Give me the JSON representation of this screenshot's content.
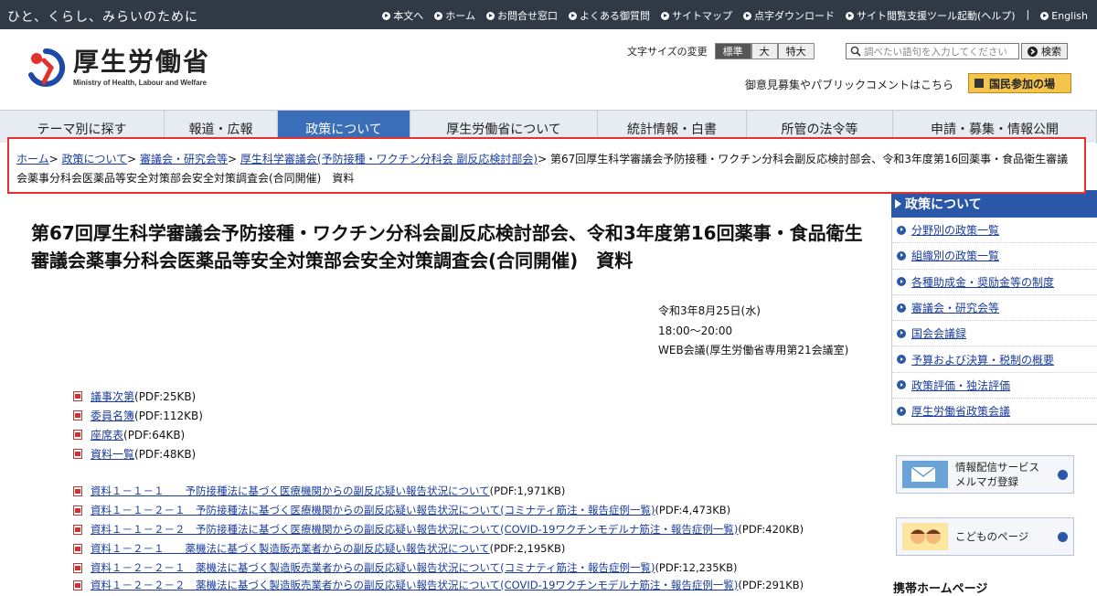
{
  "topbar": {
    "tagline": "ひと、くらし、みらいのために",
    "links": [
      "本文へ",
      "ホーム",
      "お問合せ窓口",
      "よくある御質問",
      "サイトマップ",
      "点字ダウンロード",
      "サイト閲覧支援ツール起動(ヘルプ)"
    ],
    "english": "English"
  },
  "header": {
    "logo_name": "厚生労働省",
    "logo_en": "Ministry of Health, Labour and Welfare",
    "fontsize_label": "文字サイズの変更",
    "fontsize_options": [
      "標準",
      "大",
      "特大"
    ],
    "search_placeholder": "調べたい語句を入力してください",
    "search_button": "検索",
    "public_comment": "御意見募集やパブリックコメントはこちら",
    "kokumin_button": "国民参加の場"
  },
  "nav": [
    "テーマ別に探す",
    "報道・広報",
    "政策について",
    "厚生労働省について",
    "統計情報・白書",
    "所管の法令等",
    "申請・募集・情報公開"
  ],
  "breadcrumb": {
    "links": [
      "ホーム",
      "政策について",
      "審議会・研究会等",
      "厚生科学審議会(予防接種・ワクチン分科会 副反応検討部会)"
    ],
    "current": "第67回厚生科学審議会予防接種・ワクチン分科会副反応検討部会、令和3年度第16回薬事・食品衛生審議会薬事分科会医薬品等安全対策部会安全対策調査会(合同開催)　資料"
  },
  "main": {
    "title": "第67回厚生科学審議会予防接種・ワクチン分科会副反応検討部会、令和3年度第16回薬事・食品衛生審議会薬事分科会医薬品等安全対策部会安全対策調査会(合同開催)　資料",
    "date": "令和3年8月25日(水)",
    "time": "18:00～20:00",
    "venue": "WEB会議(厚生労働省専用第21会議室)",
    "docs1": [
      {
        "label": "議事次第",
        "size": "(PDF:25KB)"
      },
      {
        "label": "委員名簿",
        "size": "(PDF:112KB)"
      },
      {
        "label": "座席表",
        "size": "(PDF:64KB)"
      },
      {
        "label": "資料一覧",
        "size": "(PDF:48KB)"
      }
    ],
    "docs2": [
      {
        "label": "資料１－１－１　　予防接種法に基づく医療機関からの副反応疑い報告状況について",
        "size": "(PDF:1,971KB)"
      },
      {
        "label": "資料１－１－２－１　予防接種法に基づく医療機関からの副反応疑い報告状況について(コミナティ筋注・報告症例一覧)",
        "size": "(PDF:4,473KB)"
      },
      {
        "label": "資料１－１－２－２　予防接種法に基づく医療機関からの副反応疑い報告状況について(COVID-19ワクチンモデルナ筋注・報告症例一覧)",
        "size": "(PDF:420KB)"
      },
      {
        "label": "資料１－２－１　　薬機法に基づく製造販売業者からの副反応疑い報告状況について",
        "size": "(PDF:2,195KB)"
      },
      {
        "label": "資料１－２－２－１　薬機法に基づく製造販売業者からの副反応疑い報告状況について(コミナティ筋注・報告症例一覧)",
        "size": "(PDF:12,235KB)"
      },
      {
        "label": "資料１－２－２－２　薬機法に基づく製造販売業者からの副反応疑い報告状況について(COVID-19ワクチンモデルナ筋注・報告症例一覧)",
        "size": "(PDF:291KB)"
      }
    ]
  },
  "sidebar": {
    "heading": "政策について",
    "items": [
      "分野別の政策一覧",
      "組織別の政策一覧",
      "各種助成金・奨励金等の制度",
      "審議会・研究会等",
      "国会会議録",
      "予算および決算・税制の概要",
      "政策評価・独法評価",
      "厚生労働省政策会議"
    ],
    "banner_mail_1": "情報配信サービス",
    "banner_mail_2": "メルマガ登録",
    "banner_kids": "こどものページ",
    "mobile": "携帯ホームページ"
  },
  "colors": {
    "topbar": "#2f3a46",
    "nav_active": "#3b6eb8",
    "highlight": "#e8302a",
    "side_head": "#2b57a8"
  }
}
